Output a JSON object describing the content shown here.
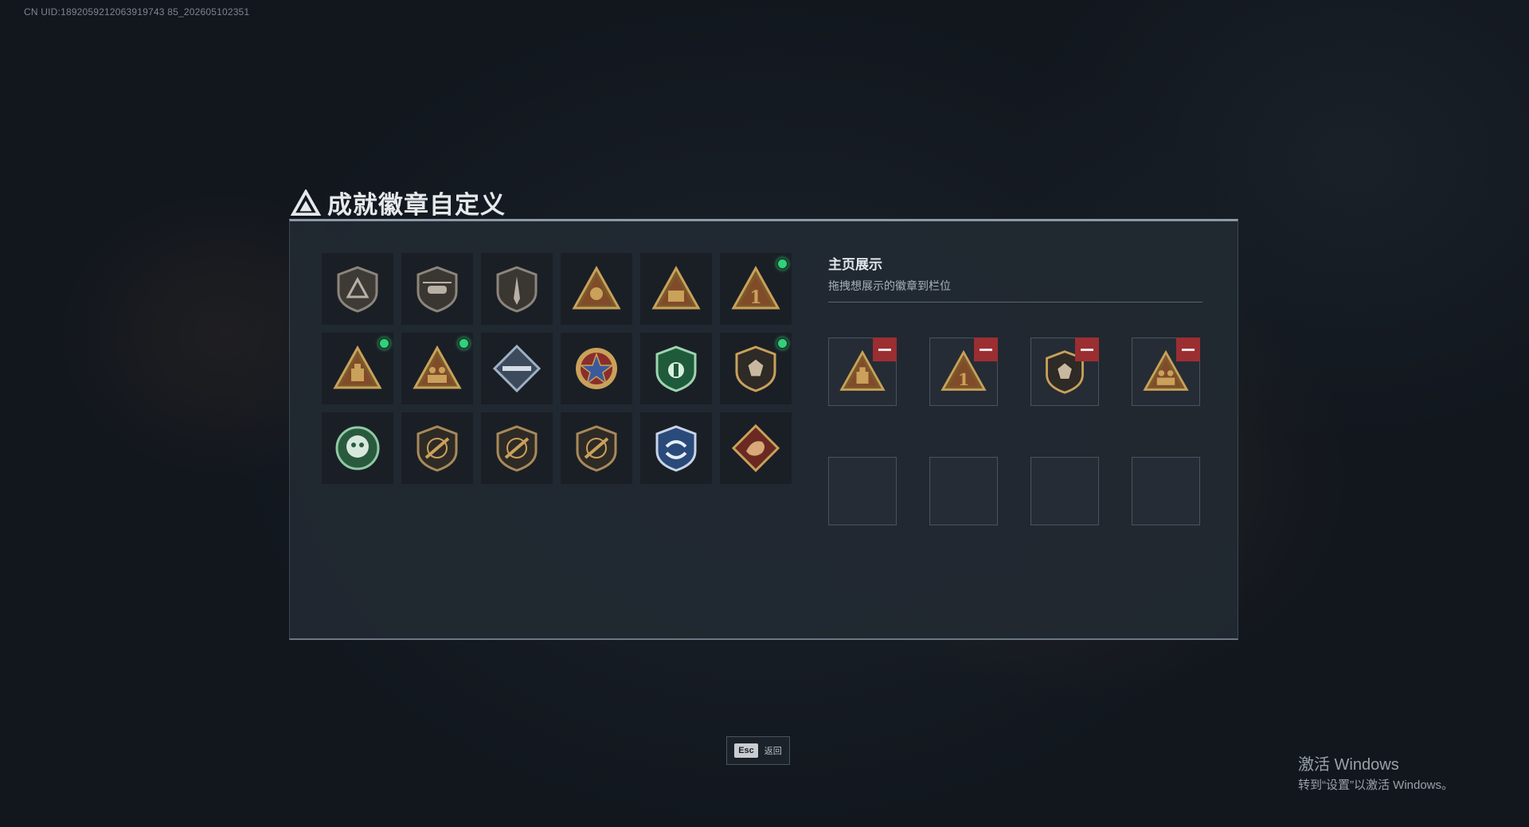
{
  "uid": "CN UID:1892059212063919743 85_202605102351",
  "title": "成就徽章自定义",
  "showcase": {
    "title": "主页展示",
    "subtitle": "拖拽想展示的徽章到栏位"
  },
  "badges": [
    {
      "icon": "grey-triangle-shield-badge",
      "new": false
    },
    {
      "icon": "helicopter-shield-badge",
      "new": false
    },
    {
      "icon": "dagger-shield-badge",
      "new": false
    },
    {
      "icon": "hand-triangle-badge",
      "new": false
    },
    {
      "icon": "ammo-triangle-badge",
      "new": false
    },
    {
      "icon": "number-one-triangle-badge",
      "new": true
    },
    {
      "icon": "crate-triangle-badge",
      "new": true
    },
    {
      "icon": "soldiers-triangle-badge",
      "new": true
    },
    {
      "icon": "rifle-diamond-badge",
      "new": false
    },
    {
      "icon": "star-medal-badge",
      "new": false
    },
    {
      "icon": "green-shield-badge",
      "new": false
    },
    {
      "icon": "gem-shield-badge",
      "new": true
    },
    {
      "icon": "green-emblem-badge",
      "new": false
    },
    {
      "icon": "rifle-shield-badge-1",
      "new": false
    },
    {
      "icon": "rifle-shield-badge-2",
      "new": false
    },
    {
      "icon": "rifle-shield-badge-3",
      "new": false
    },
    {
      "icon": "blue-arrows-shield-badge",
      "new": false
    },
    {
      "icon": "dragon-diamond-badge",
      "new": false
    }
  ],
  "slots": [
    {
      "icon": "crate-triangle-badge"
    },
    {
      "icon": "number-one-triangle-badge"
    },
    {
      "icon": "gem-shield-badge"
    },
    {
      "icon": "soldiers-triangle-badge"
    },
    {
      "icon": ""
    },
    {
      "icon": ""
    },
    {
      "icon": ""
    },
    {
      "icon": ""
    }
  ],
  "esc": {
    "key": "Esc",
    "label": "返回"
  },
  "watermark": {
    "line1": "激活 Windows",
    "line2": "转到“设置”以激活 Windows。"
  },
  "colors": {
    "accent_green": "#2fd27a",
    "remove_red": "#9b2e31",
    "gold": "#c9a15a",
    "panel": "#222932"
  }
}
